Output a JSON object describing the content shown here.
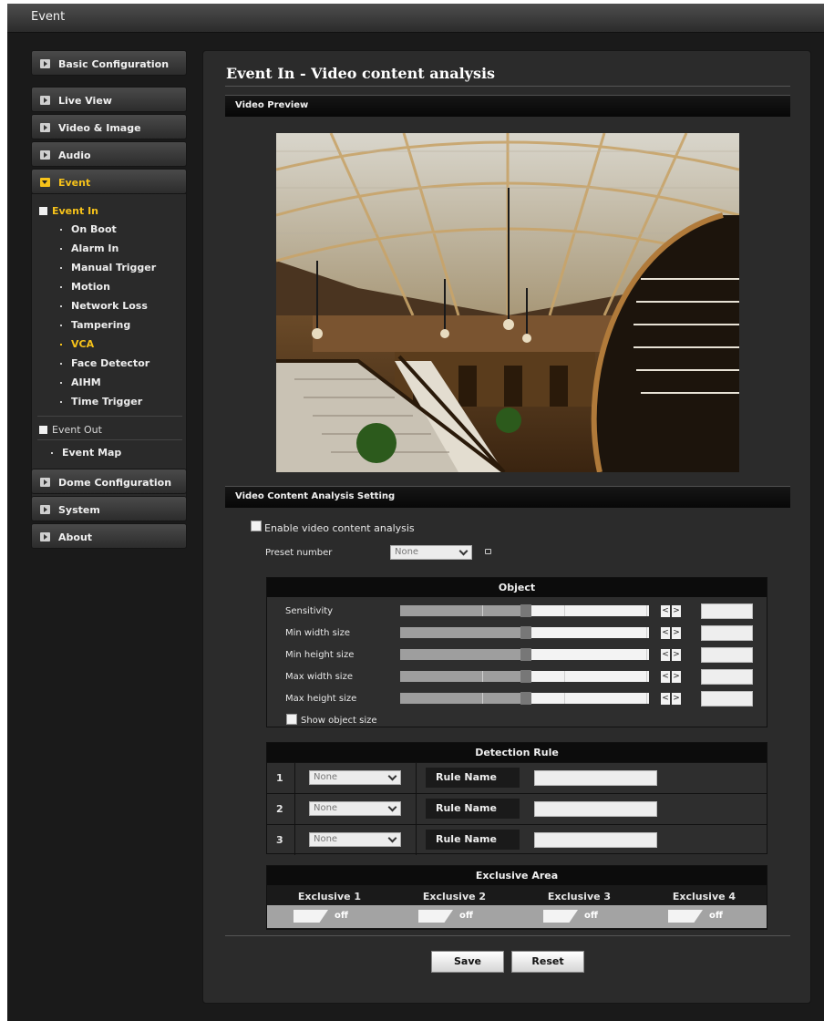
{
  "window": {
    "title": "Event"
  },
  "sidebar": {
    "top_items": [
      {
        "label": "Basic Configuration"
      },
      {
        "label": "Live View"
      },
      {
        "label": "Video & Image"
      },
      {
        "label": "Audio"
      },
      {
        "label": "Event",
        "active": true
      }
    ],
    "event_submenu": {
      "event_in_label": "Event In",
      "event_in_items": [
        {
          "label": "On Boot"
        },
        {
          "label": "Alarm In"
        },
        {
          "label": "Manual Trigger"
        },
        {
          "label": "Motion"
        },
        {
          "label": "Network Loss"
        },
        {
          "label": "Tampering"
        },
        {
          "label": "VCA",
          "selected": true
        },
        {
          "label": "Face Detector"
        },
        {
          "label": "AIHM"
        },
        {
          "label": "Time Trigger"
        }
      ],
      "event_out_label": "Event Out",
      "event_map_label": "Event Map"
    },
    "bottom_items": [
      {
        "label": "Dome Configuration"
      },
      {
        "label": "System"
      },
      {
        "label": "About"
      }
    ]
  },
  "main": {
    "title": "Event In - Video content analysis",
    "video_preview_header": "Video Preview",
    "settings_header": "Video Content Analysis Setting",
    "enable_label": "Enable video content analysis",
    "enable_checked": false,
    "preset_label": "Preset number",
    "preset_value": "None",
    "object": {
      "header": "Object",
      "rows": [
        {
          "label": "Sensitivity",
          "value": ""
        },
        {
          "label": "Min width size",
          "value": ""
        },
        {
          "label": "Min height size",
          "value": ""
        },
        {
          "label": "Max width size",
          "value": ""
        },
        {
          "label": "Max height size",
          "value": ""
        }
      ],
      "show_size_label": "Show object size",
      "show_size_checked": false
    },
    "detection_rule": {
      "header": "Detection Rule",
      "rows": [
        {
          "num": "1",
          "select": "None",
          "name_label": "Rule Name",
          "name_value": ""
        },
        {
          "num": "2",
          "select": "None",
          "name_label": "Rule Name",
          "name_value": ""
        },
        {
          "num": "3",
          "select": "None",
          "name_label": "Rule Name",
          "name_value": ""
        }
      ]
    },
    "exclusive_area": {
      "header": "Exclusive Area",
      "areas": [
        {
          "label": "Exclusive 1",
          "state": "off"
        },
        {
          "label": "Exclusive 2",
          "state": "off"
        },
        {
          "label": "Exclusive 3",
          "state": "off"
        },
        {
          "label": "Exclusive 4",
          "state": "off"
        }
      ]
    },
    "buttons": {
      "save": "Save",
      "reset": "Reset"
    }
  },
  "colors": {
    "accent": "#f6c21a",
    "panel": "#2b2b2b",
    "header_bar": "#0c0c0c"
  }
}
